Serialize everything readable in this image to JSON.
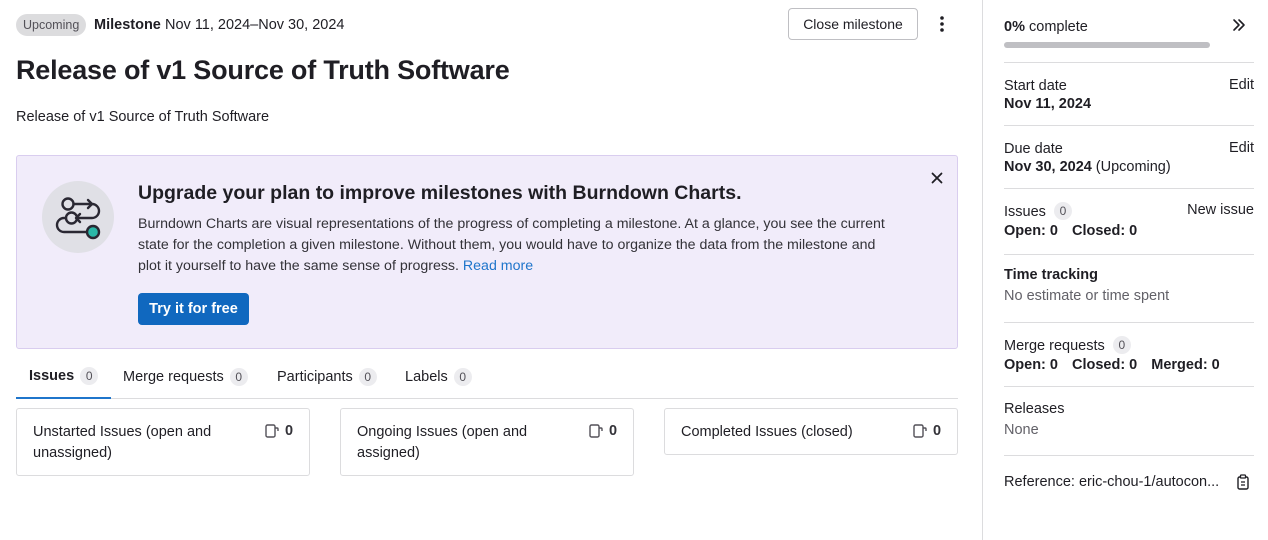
{
  "header": {
    "status": "Upcoming",
    "milestone_label": "Milestone",
    "milestone_dates": "Nov 11, 2024–Nov 30, 2024",
    "close_button": "Close milestone"
  },
  "page": {
    "title": "Release of v1 Source of Truth Software",
    "description": "Release of v1 Source of Truth Software"
  },
  "promo": {
    "title": "Upgrade your plan to improve milestones with Burndown Charts.",
    "body": "Burndown Charts are visual representations of the progress of completing a milestone. At a glance, you see the current state for the completion a given milestone. Without them, you would have to organize the data from the milestone and plot it yourself to have the same sense of progress.",
    "link": "Read more",
    "cta": "Try it for free"
  },
  "tabs": [
    {
      "label": "Issues",
      "count": "0"
    },
    {
      "label": "Merge requests",
      "count": "0"
    },
    {
      "label": "Participants",
      "count": "0"
    },
    {
      "label": "Labels",
      "count": "0"
    }
  ],
  "columns": [
    {
      "title": "Unstarted Issues (open and unassigned)",
      "count": "0"
    },
    {
      "title": "Ongoing Issues (open and assigned)",
      "count": "0"
    },
    {
      "title": "Completed Issues (closed)",
      "count": "0"
    }
  ],
  "sidebar": {
    "progress_percent": "0%",
    "progress_suffix": "complete",
    "progress_fraction": 0,
    "start_date_label": "Start date",
    "start_date": "Nov 11, 2024",
    "due_date_label": "Due date",
    "due_date": "Nov 30, 2024",
    "due_date_note": "(Upcoming)",
    "edit_label": "Edit",
    "issues_label": "Issues",
    "issues_count": "0",
    "new_issue": "New issue",
    "issues_open": "Open: 0",
    "issues_closed": "Closed: 0",
    "time_tracking_label": "Time tracking",
    "time_tracking_value": "No estimate or time spent",
    "mr_label": "Merge requests",
    "mr_count": "0",
    "mr_open": "Open: 0",
    "mr_closed": "Closed: 0",
    "mr_merged": "Merged: 0",
    "releases_label": "Releases",
    "releases_value": "None",
    "reference": "Reference: eric-chou-1/autocon..."
  },
  "colors": {
    "accent": "#1f75cb",
    "button_primary": "#1068bf",
    "promo_bg": "#f1ecfa",
    "progress_fill": "#108548"
  }
}
